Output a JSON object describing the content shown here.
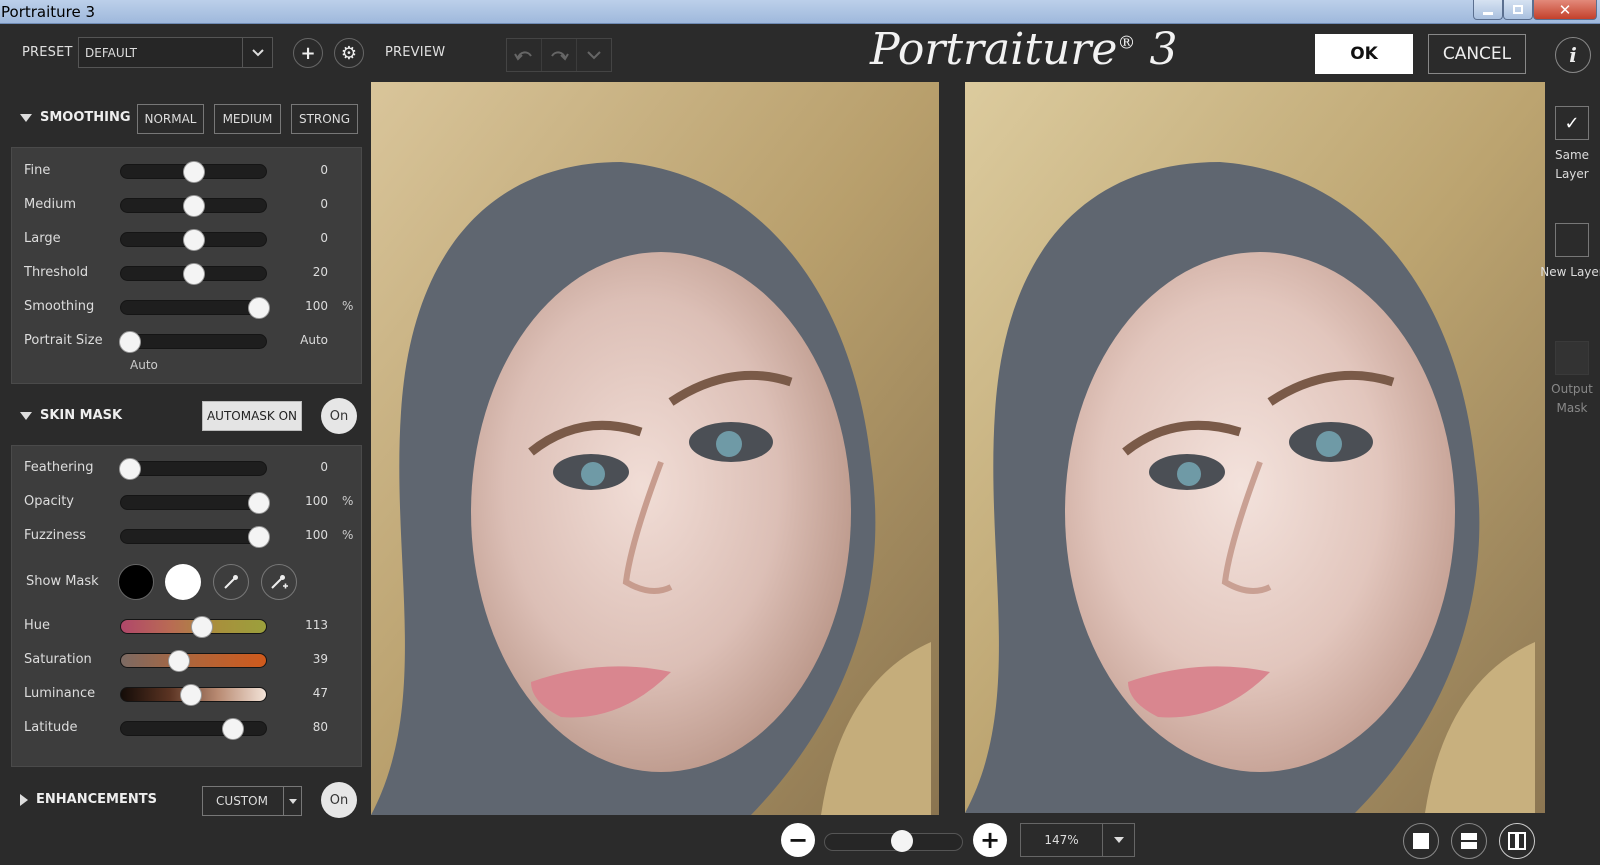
{
  "window": {
    "title": "Portraiture 3",
    "close_glyph": "✕"
  },
  "toolbar": {
    "preset_label": "PRESET",
    "preset_value": "DEFAULT",
    "preview_label": "PREVIEW",
    "logo_text": "Portraiture",
    "logo_mark": "®",
    "logo_version": "3",
    "ok_label": "OK",
    "cancel_label": "CANCEL",
    "info_glyph": "i",
    "add_glyph": "+",
    "settings_glyph": "⚙"
  },
  "smoothing": {
    "header": "SMOOTHING",
    "buttons": [
      "NORMAL",
      "MEDIUM",
      "STRONG"
    ],
    "sliders": [
      {
        "name": "Fine",
        "value": "0",
        "unit": ""
      },
      {
        "name": "Medium",
        "value": "0",
        "unit": ""
      },
      {
        "name": "Large",
        "value": "0",
        "unit": ""
      },
      {
        "name": "Threshold",
        "value": "20",
        "unit": ""
      },
      {
        "name": "Smoothing",
        "value": "100",
        "unit": "%"
      },
      {
        "name": "Portrait Size",
        "value": "Auto",
        "unit": ""
      }
    ],
    "portrait_size_sub": "Auto"
  },
  "skin_mask": {
    "header": "SKIN MASK",
    "automask_label": "AUTOMASK ON",
    "on_label": "On",
    "sliders": [
      {
        "name": "Feathering",
        "value": "0",
        "unit": ""
      },
      {
        "name": "Opacity",
        "value": "100",
        "unit": "%"
      },
      {
        "name": "Fuzziness",
        "value": "100",
        "unit": "%"
      }
    ],
    "show_mask_label": "Show Mask",
    "color_sliders": [
      {
        "name": "Hue",
        "value": "113"
      },
      {
        "name": "Saturation",
        "value": "39"
      },
      {
        "name": "Luminance",
        "value": "47"
      },
      {
        "name": "Latitude",
        "value": "80"
      }
    ]
  },
  "enhancements": {
    "header": "ENHANCEMENTS",
    "mode_value": "CUSTOM",
    "on_label": "On"
  },
  "output": {
    "same_layer": "Same Layer",
    "new_layer": "New Layer",
    "output_mask": "Output Mask",
    "check_glyph": "✓"
  },
  "zoom": {
    "value": "147%",
    "minus_glyph": "−",
    "plus_glyph": "+"
  },
  "colors": {
    "background": "#2b2b2b",
    "panel": "#3d3d3d",
    "titlebar": "#9fb8dc"
  }
}
